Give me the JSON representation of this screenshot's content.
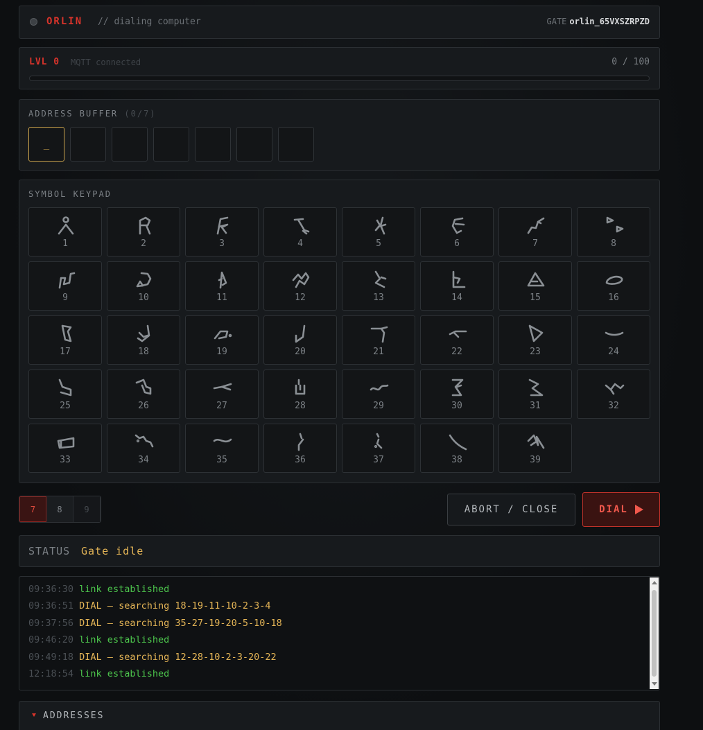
{
  "header": {
    "name": "ORLIN",
    "subtitle": "// dialing computer",
    "gate_label": "GATE",
    "gate_id": "orlin_65VXSZRPZD"
  },
  "level": {
    "label": "LVL 0",
    "connection": "MQTT connected",
    "progress_text": "0 / 100",
    "progress_fraction": 0
  },
  "address_buffer": {
    "title": "ADDRESS BUFFER",
    "count": "(0/7)",
    "slots": [
      "_",
      "",
      "",
      "",
      "",
      "",
      ""
    ]
  },
  "keypad": {
    "title": "SYMBOL KEYPAD",
    "keys": [
      {
        "num": "1",
        "icon": "glyph-1"
      },
      {
        "num": "2",
        "icon": "glyph-2"
      },
      {
        "num": "3",
        "icon": "glyph-3"
      },
      {
        "num": "4",
        "icon": "glyph-4"
      },
      {
        "num": "5",
        "icon": "glyph-5"
      },
      {
        "num": "6",
        "icon": "glyph-6"
      },
      {
        "num": "7",
        "icon": "glyph-7"
      },
      {
        "num": "8",
        "icon": "glyph-8"
      },
      {
        "num": "9",
        "icon": "glyph-9"
      },
      {
        "num": "10",
        "icon": "glyph-10"
      },
      {
        "num": "11",
        "icon": "glyph-11"
      },
      {
        "num": "12",
        "icon": "glyph-12"
      },
      {
        "num": "13",
        "icon": "glyph-13"
      },
      {
        "num": "14",
        "icon": "glyph-14"
      },
      {
        "num": "15",
        "icon": "glyph-15"
      },
      {
        "num": "16",
        "icon": "glyph-16"
      },
      {
        "num": "17",
        "icon": "glyph-17"
      },
      {
        "num": "18",
        "icon": "glyph-18"
      },
      {
        "num": "19",
        "icon": "glyph-19"
      },
      {
        "num": "20",
        "icon": "glyph-20"
      },
      {
        "num": "21",
        "icon": "glyph-21"
      },
      {
        "num": "22",
        "icon": "glyph-22"
      },
      {
        "num": "23",
        "icon": "glyph-23"
      },
      {
        "num": "24",
        "icon": "glyph-24"
      },
      {
        "num": "25",
        "icon": "glyph-25"
      },
      {
        "num": "26",
        "icon": "glyph-26"
      },
      {
        "num": "27",
        "icon": "glyph-27"
      },
      {
        "num": "28",
        "icon": "glyph-28"
      },
      {
        "num": "29",
        "icon": "glyph-29"
      },
      {
        "num": "30",
        "icon": "glyph-30"
      },
      {
        "num": "31",
        "icon": "glyph-31"
      },
      {
        "num": "32",
        "icon": "glyph-32"
      },
      {
        "num": "33",
        "icon": "glyph-33"
      },
      {
        "num": "34",
        "icon": "glyph-34"
      },
      {
        "num": "35",
        "icon": "glyph-35"
      },
      {
        "num": "36",
        "icon": "glyph-36"
      },
      {
        "num": "37",
        "icon": "glyph-37"
      },
      {
        "num": "38",
        "icon": "glyph-38"
      },
      {
        "num": "39",
        "icon": "glyph-39"
      }
    ]
  },
  "pager": {
    "pages": [
      {
        "label": "7",
        "state": "selected"
      },
      {
        "label": "8",
        "state": "normal"
      },
      {
        "label": "9",
        "state": "disabled"
      }
    ]
  },
  "actions": {
    "abort_label": "ABORT / CLOSE",
    "dial_label": "DIAL"
  },
  "status": {
    "label": "STATUS",
    "value": "Gate idle"
  },
  "log": [
    {
      "time": "09:36:30",
      "msg": "link established",
      "kind": "ok"
    },
    {
      "time": "09:36:51",
      "msg": "DIAL — searching 18-19-11-10-2-3-4",
      "kind": "dial"
    },
    {
      "time": "09:37:56",
      "msg": "DIAL — searching 35-27-19-20-5-10-18",
      "kind": "dial"
    },
    {
      "time": "09:46:20",
      "msg": "link established",
      "kind": "ok"
    },
    {
      "time": "09:49:18",
      "msg": "DIAL — searching 12-28-10-2-3-20-22",
      "kind": "dial"
    },
    {
      "time": "12:18:54",
      "msg": "link established",
      "kind": "ok"
    }
  ],
  "addresses": {
    "title": "ADDRESSES"
  },
  "colors": {
    "accent_red": "#d9342b",
    "amber": "#e3b456",
    "ok_green": "#4cc44c"
  }
}
